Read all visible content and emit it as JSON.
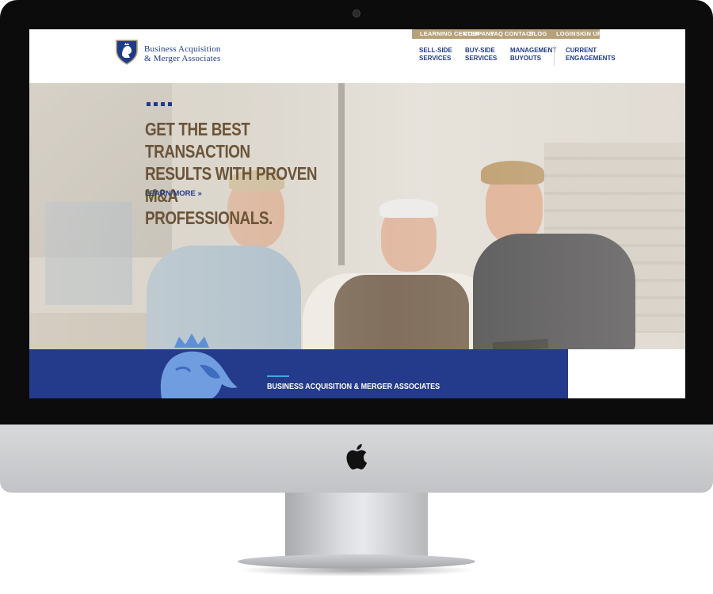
{
  "brand": {
    "line1": "Business Acquisition",
    "line2": "& Merger Associates"
  },
  "top_links": [
    "LEARNING CENTER",
    "COMPANY",
    "FAQ",
    "CONTACT",
    "BLOG",
    "LOGIN",
    "SIGN UP"
  ],
  "nav": {
    "sell_side": [
      "SELL-SIDE",
      "SERVICES"
    ],
    "buy_side": [
      "BUY-SIDE",
      "SERVICES"
    ],
    "management": [
      "MANAGEMENT",
      "BUYOUTS"
    ],
    "current": [
      "CURRENT",
      "ENGAGEMENTS"
    ]
  },
  "hero": {
    "headline_lines": [
      "GET THE BEST TRANSACTION",
      "RESULTS WITH PROVEN M&A",
      "PROFESSIONALS."
    ],
    "cta": "LEARN MORE »"
  },
  "banner": {
    "title": "BUSINESS ACQUISITION & MERGER ASSOCIATES"
  },
  "colors": {
    "brand_blue": "#243a8a",
    "tan": "#b6a179",
    "headline_brown": "#6b5438",
    "accent_light_blue": "#4aa3df"
  },
  "icons": [
    "shield-logo-icon",
    "lion-crest-icon",
    "apple-logo-icon"
  ]
}
